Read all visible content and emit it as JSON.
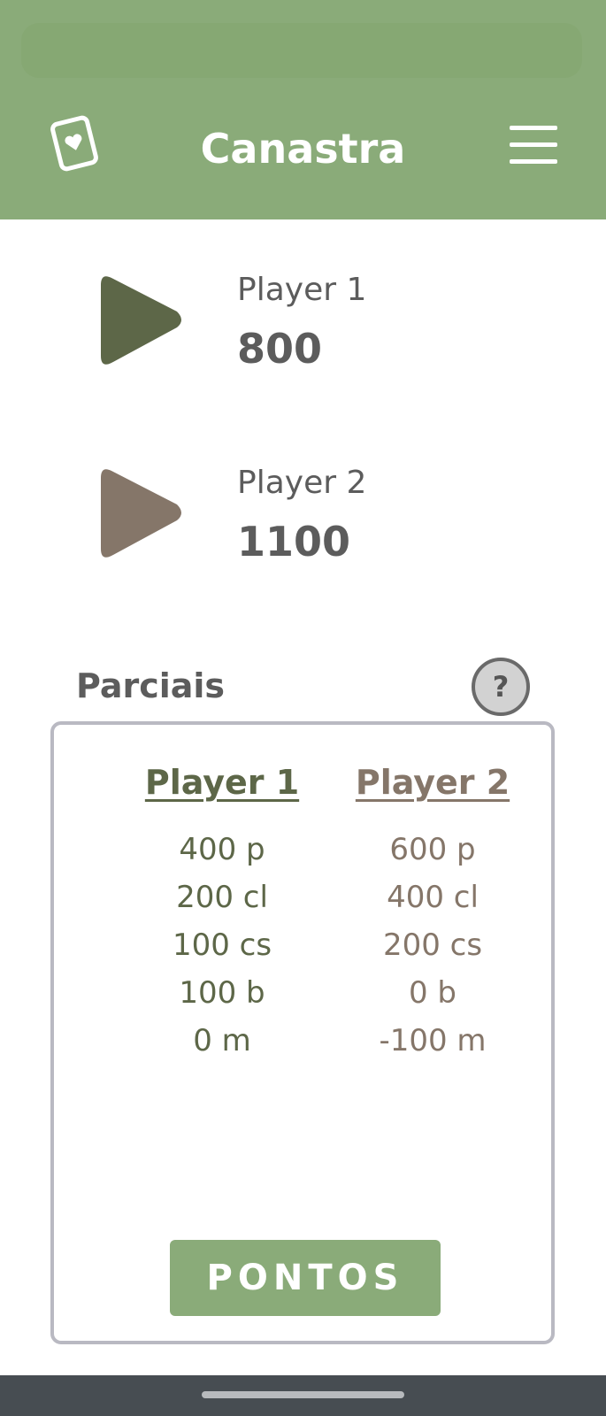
{
  "header": {
    "title": "Canastra",
    "logo_icon": "card-heart-icon",
    "menu_icon": "hamburger-menu-icon",
    "background_color": "#8aab79"
  },
  "players": [
    {
      "name": "Player 1",
      "score": "800",
      "color": "#5d6748",
      "play_icon": "play-triangle-icon"
    },
    {
      "name": "Player 2",
      "score": "1100",
      "color": "#857669",
      "play_icon": "play-triangle-icon"
    }
  ],
  "parciais": {
    "title": "Parciais",
    "help_label": "?",
    "columns": [
      {
        "header": "Player 1",
        "color": "#5d6748",
        "items": [
          "400 p",
          "200 cl",
          "100 cs",
          "100 b",
          "0 m"
        ]
      },
      {
        "header": "Player 2",
        "color": "#857669",
        "items": [
          "600 p",
          "400 cl",
          "200 cs",
          "0 b",
          "-100 m"
        ]
      }
    ],
    "button_label": "PONTOS"
  }
}
